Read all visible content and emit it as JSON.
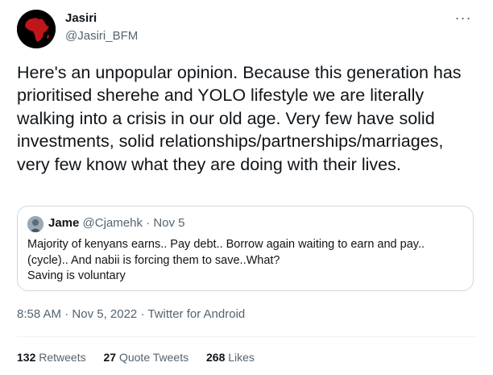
{
  "author": {
    "name": "Jasiri",
    "handle": "@Jasiri_BFM",
    "avatar_icon": "africa-map-avatar",
    "avatar_color": "#c0151b"
  },
  "more_icon": "···",
  "body": "Here's an unpopular opinion. Because this generation has prioritised sherehe and YOLO lifestyle we are literally walking into a crisis in our old age. Very few have solid investments, solid relationships/partnerships/marriages, very few know what they are doing with their lives.",
  "quote": {
    "name": "Jame",
    "handle": "@Cjamehk",
    "separator": "·",
    "date": "Nov 5",
    "text_line1": "Majority of kenyans earns.. Pay debt.. Borrow again waiting to earn and pay..",
    "text_line2": "(cycle).. And nabii is forcing them to save..What?",
    "text_line3": "Saving is voluntary"
  },
  "meta": {
    "time": "8:58 AM",
    "separator": "·",
    "date": "Nov 5, 2022",
    "source": "Twitter for Android"
  },
  "stats": {
    "retweets_count": "132",
    "retweets_label": "Retweets",
    "quotes_count": "27",
    "quotes_label": "Quote Tweets",
    "likes_count": "268",
    "likes_label": "Likes"
  },
  "colors": {
    "text": "#0f1419",
    "secondary": "#536471",
    "border": "#cfd9de"
  }
}
